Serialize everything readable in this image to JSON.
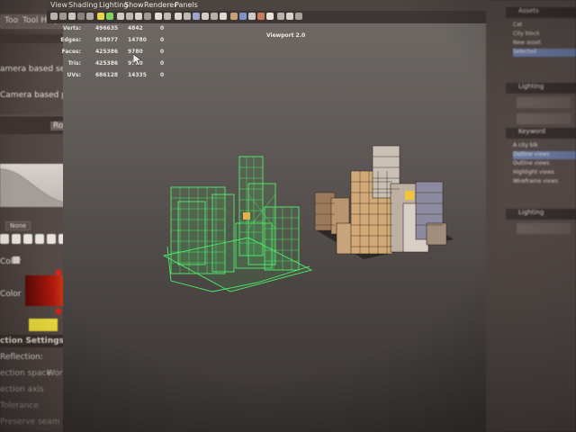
{
  "left_panel": {
    "tabs": [
      "Tool",
      "Tool Help"
    ],
    "lines": [
      "amera based selec",
      "Camera based paint"
    ],
    "dropdown": "None",
    "labels": [
      "Color",
      "Color"
    ],
    "section_title": "ction Settings",
    "reflection_label": "Reflection:",
    "rows": [
      "ection space",
      "ection axis",
      "Tolerance",
      "Preserve seam"
    ],
    "world_value": "World",
    "small_button": "Ro"
  },
  "menu": {
    "items": [
      "View",
      "Shading",
      "Lighting",
      "Show",
      "Renderer",
      "Panels"
    ]
  },
  "viewport": {
    "title": "Viewport 2.0",
    "stats": [
      {
        "label": "Verts:",
        "values": [
          "496635",
          "4842",
          "0"
        ]
      },
      {
        "label": "Edges:",
        "values": [
          "858977",
          "14780",
          "0"
        ]
      },
      {
        "label": "Faces:",
        "values": [
          "425386",
          "9780",
          "0"
        ]
      },
      {
        "label": "Tris:",
        "values": [
          "425386",
          "9780",
          "0"
        ]
      },
      {
        "label": "UVs:",
        "values": [
          "686128",
          "14335",
          "0"
        ]
      }
    ]
  },
  "right_panel": {
    "assets": "Assets",
    "asset_items": [
      "Cat",
      "City block",
      "New asset",
      "Selected"
    ],
    "lighting": "Lighting",
    "keyword": "Keyword",
    "keyword_items": [
      "A city blk",
      "Outline views",
      "Outline views",
      "Highlight views",
      "Wireframe views"
    ],
    "lighting2": "Lighting"
  },
  "colors": {
    "wireframe": "#4cf06a",
    "building_tan": "#d2aa78",
    "accent_red": "#c01a10",
    "accent_yellow": "#f1e23c"
  }
}
